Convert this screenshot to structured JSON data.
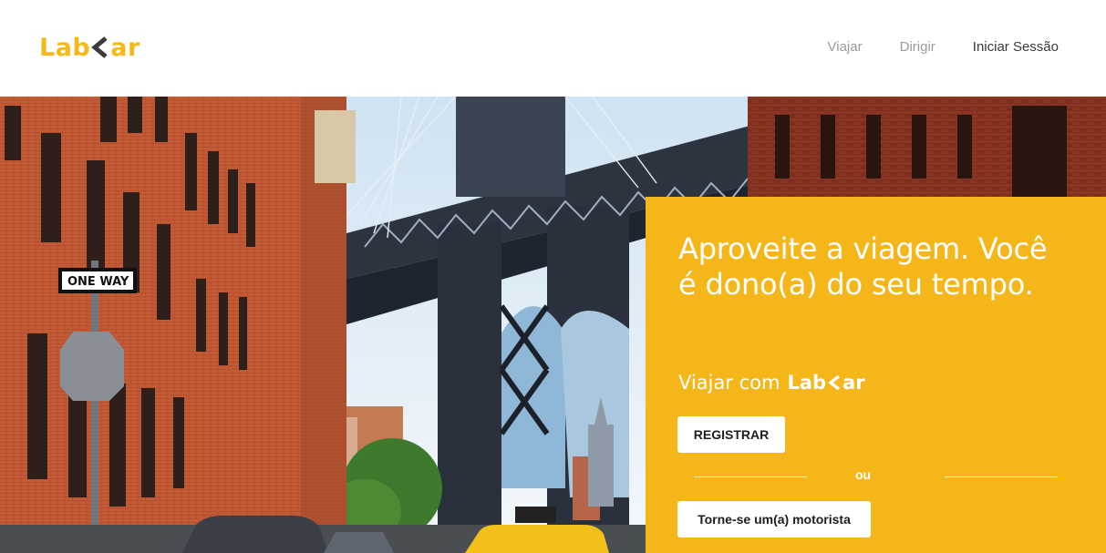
{
  "header": {
    "logo_left": "Lab",
    "logo_right": "ar",
    "nav": [
      {
        "label": "Viajar"
      },
      {
        "label": "Dirigir"
      },
      {
        "label": "Iniciar Sessão"
      }
    ]
  },
  "hero": {
    "headline": "Aproveite a viagem. Você é dono(a) do seu tempo.",
    "sub_text": "Viajar com",
    "brand_left": "Lab",
    "brand_right": "ar",
    "register_button": "REGISTRAR",
    "or_text": "ou",
    "driver_button": "Torne-se um(a) motorista",
    "sign_text": "ONE WAY"
  },
  "colors": {
    "brand_yellow": "#f5b61a",
    "nav_muted": "#9a9a9a",
    "nav_strong": "#3a3a3a"
  }
}
